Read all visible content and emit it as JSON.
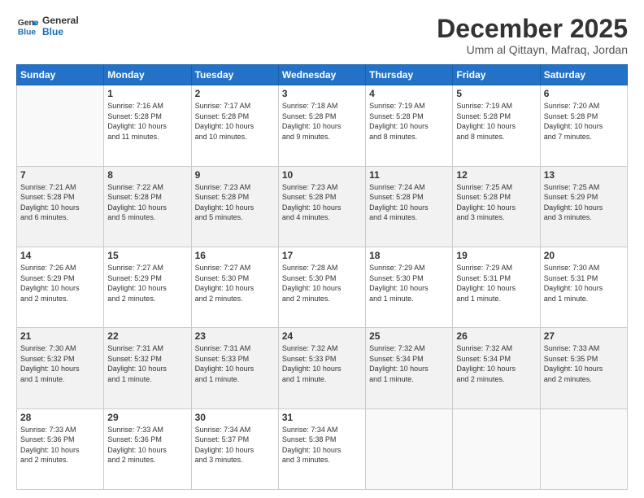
{
  "logo": {
    "line1": "General",
    "line2": "Blue"
  },
  "header": {
    "month": "December 2025",
    "location": "Umm al Qittayn, Mafraq, Jordan"
  },
  "weekdays": [
    "Sunday",
    "Monday",
    "Tuesday",
    "Wednesday",
    "Thursday",
    "Friday",
    "Saturday"
  ],
  "weeks": [
    [
      {
        "day": "",
        "info": ""
      },
      {
        "day": "1",
        "info": "Sunrise: 7:16 AM\nSunset: 5:28 PM\nDaylight: 10 hours\nand 11 minutes."
      },
      {
        "day": "2",
        "info": "Sunrise: 7:17 AM\nSunset: 5:28 PM\nDaylight: 10 hours\nand 10 minutes."
      },
      {
        "day": "3",
        "info": "Sunrise: 7:18 AM\nSunset: 5:28 PM\nDaylight: 10 hours\nand 9 minutes."
      },
      {
        "day": "4",
        "info": "Sunrise: 7:19 AM\nSunset: 5:28 PM\nDaylight: 10 hours\nand 8 minutes."
      },
      {
        "day": "5",
        "info": "Sunrise: 7:19 AM\nSunset: 5:28 PM\nDaylight: 10 hours\nand 8 minutes."
      },
      {
        "day": "6",
        "info": "Sunrise: 7:20 AM\nSunset: 5:28 PM\nDaylight: 10 hours\nand 7 minutes."
      }
    ],
    [
      {
        "day": "7",
        "info": "Sunrise: 7:21 AM\nSunset: 5:28 PM\nDaylight: 10 hours\nand 6 minutes."
      },
      {
        "day": "8",
        "info": "Sunrise: 7:22 AM\nSunset: 5:28 PM\nDaylight: 10 hours\nand 5 minutes."
      },
      {
        "day": "9",
        "info": "Sunrise: 7:23 AM\nSunset: 5:28 PM\nDaylight: 10 hours\nand 5 minutes."
      },
      {
        "day": "10",
        "info": "Sunrise: 7:23 AM\nSunset: 5:28 PM\nDaylight: 10 hours\nand 4 minutes."
      },
      {
        "day": "11",
        "info": "Sunrise: 7:24 AM\nSunset: 5:28 PM\nDaylight: 10 hours\nand 4 minutes."
      },
      {
        "day": "12",
        "info": "Sunrise: 7:25 AM\nSunset: 5:28 PM\nDaylight: 10 hours\nand 3 minutes."
      },
      {
        "day": "13",
        "info": "Sunrise: 7:25 AM\nSunset: 5:29 PM\nDaylight: 10 hours\nand 3 minutes."
      }
    ],
    [
      {
        "day": "14",
        "info": "Sunrise: 7:26 AM\nSunset: 5:29 PM\nDaylight: 10 hours\nand 2 minutes."
      },
      {
        "day": "15",
        "info": "Sunrise: 7:27 AM\nSunset: 5:29 PM\nDaylight: 10 hours\nand 2 minutes."
      },
      {
        "day": "16",
        "info": "Sunrise: 7:27 AM\nSunset: 5:30 PM\nDaylight: 10 hours\nand 2 minutes."
      },
      {
        "day": "17",
        "info": "Sunrise: 7:28 AM\nSunset: 5:30 PM\nDaylight: 10 hours\nand 2 minutes."
      },
      {
        "day": "18",
        "info": "Sunrise: 7:29 AM\nSunset: 5:30 PM\nDaylight: 10 hours\nand 1 minute."
      },
      {
        "day": "19",
        "info": "Sunrise: 7:29 AM\nSunset: 5:31 PM\nDaylight: 10 hours\nand 1 minute."
      },
      {
        "day": "20",
        "info": "Sunrise: 7:30 AM\nSunset: 5:31 PM\nDaylight: 10 hours\nand 1 minute."
      }
    ],
    [
      {
        "day": "21",
        "info": "Sunrise: 7:30 AM\nSunset: 5:32 PM\nDaylight: 10 hours\nand 1 minute."
      },
      {
        "day": "22",
        "info": "Sunrise: 7:31 AM\nSunset: 5:32 PM\nDaylight: 10 hours\nand 1 minute."
      },
      {
        "day": "23",
        "info": "Sunrise: 7:31 AM\nSunset: 5:33 PM\nDaylight: 10 hours\nand 1 minute."
      },
      {
        "day": "24",
        "info": "Sunrise: 7:32 AM\nSunset: 5:33 PM\nDaylight: 10 hours\nand 1 minute."
      },
      {
        "day": "25",
        "info": "Sunrise: 7:32 AM\nSunset: 5:34 PM\nDaylight: 10 hours\nand 1 minute."
      },
      {
        "day": "26",
        "info": "Sunrise: 7:32 AM\nSunset: 5:34 PM\nDaylight: 10 hours\nand 2 minutes."
      },
      {
        "day": "27",
        "info": "Sunrise: 7:33 AM\nSunset: 5:35 PM\nDaylight: 10 hours\nand 2 minutes."
      }
    ],
    [
      {
        "day": "28",
        "info": "Sunrise: 7:33 AM\nSunset: 5:36 PM\nDaylight: 10 hours\nand 2 minutes."
      },
      {
        "day": "29",
        "info": "Sunrise: 7:33 AM\nSunset: 5:36 PM\nDaylight: 10 hours\nand 2 minutes."
      },
      {
        "day": "30",
        "info": "Sunrise: 7:34 AM\nSunset: 5:37 PM\nDaylight: 10 hours\nand 3 minutes."
      },
      {
        "day": "31",
        "info": "Sunrise: 7:34 AM\nSunset: 5:38 PM\nDaylight: 10 hours\nand 3 minutes."
      },
      {
        "day": "",
        "info": ""
      },
      {
        "day": "",
        "info": ""
      },
      {
        "day": "",
        "info": ""
      }
    ]
  ]
}
